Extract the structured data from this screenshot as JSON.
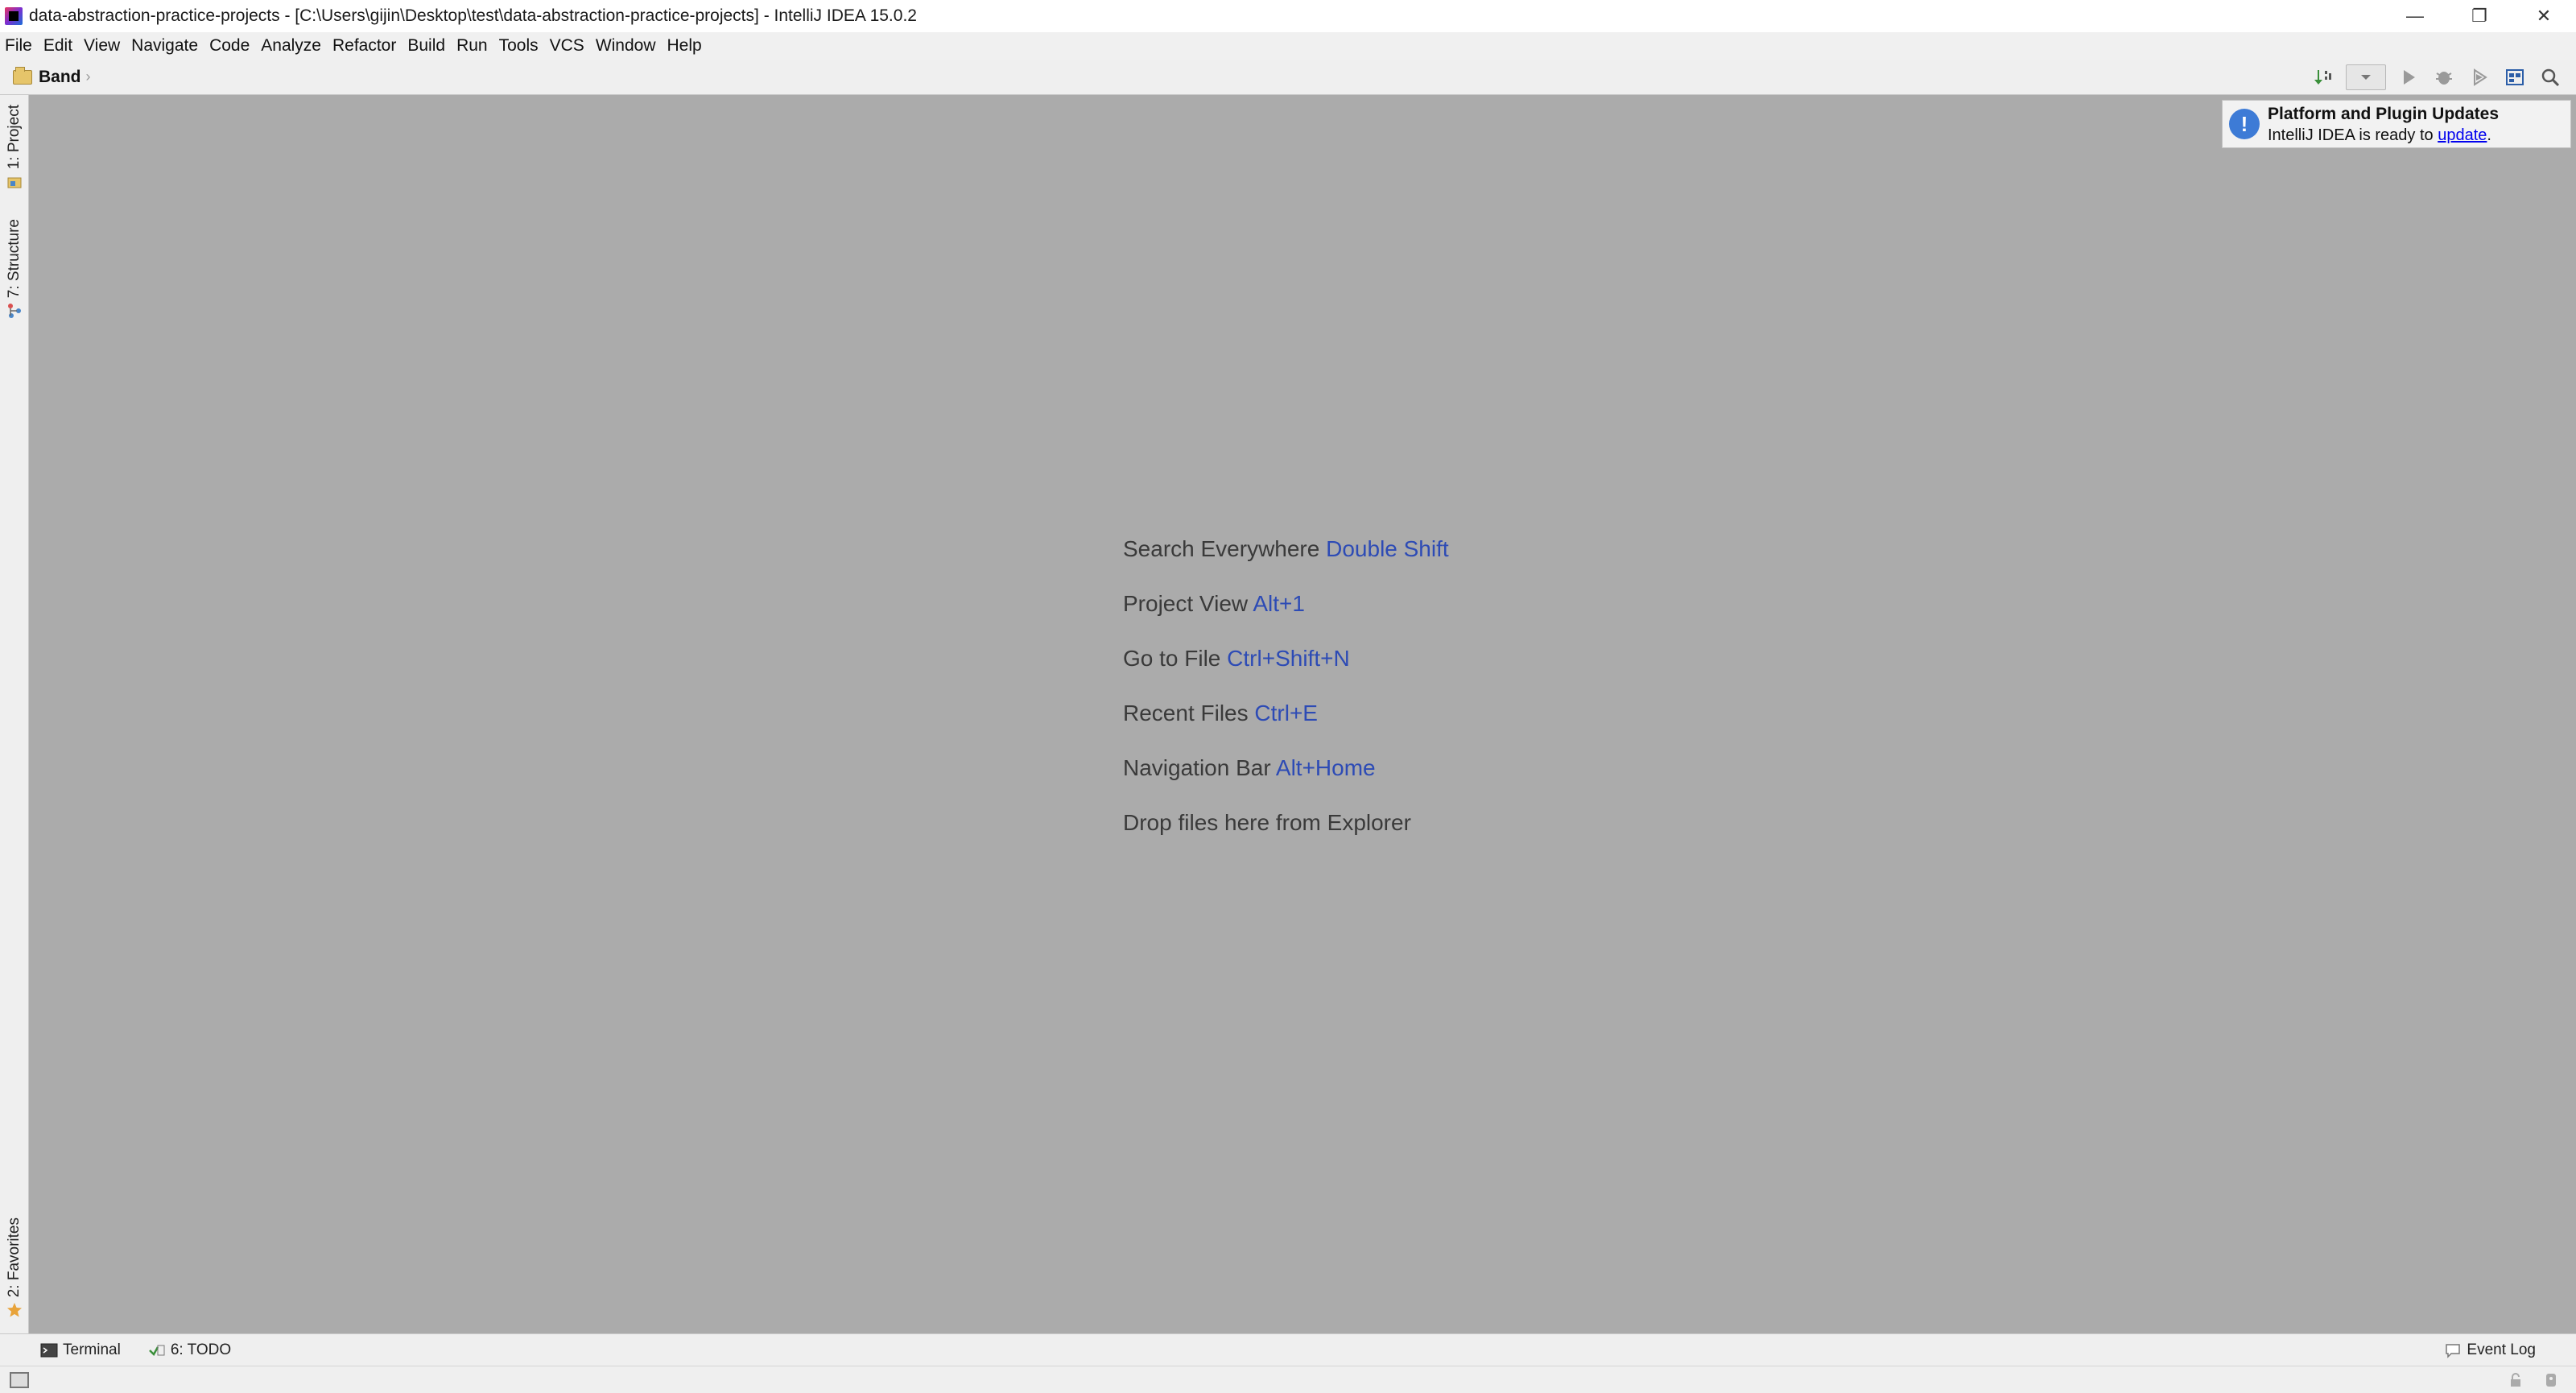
{
  "window": {
    "title": "data-abstraction-practice-projects - [C:\\Users\\gijin\\Desktop\\test\\data-abstraction-practice-projects] - IntelliJ IDEA 15.0.2",
    "controls": {
      "minimize": "—",
      "restore": "❐",
      "close": "✕"
    }
  },
  "menu": [
    "File",
    "Edit",
    "View",
    "Navigate",
    "Code",
    "Analyze",
    "Refactor",
    "Build",
    "Run",
    "Tools",
    "VCS",
    "Window",
    "Help"
  ],
  "navbar": {
    "breadcrumb": "Band"
  },
  "left_strip": {
    "project_tab": "1: Project",
    "structure_tab": "7: Structure",
    "favorites_tab": "2: Favorites"
  },
  "editor_hints": [
    {
      "text": "Search Everywhere",
      "shortcut": "Double Shift"
    },
    {
      "text": "Project View",
      "shortcut": "Alt+1"
    },
    {
      "text": "Go to File",
      "shortcut": "Ctrl+Shift+N"
    },
    {
      "text": "Recent Files",
      "shortcut": "Ctrl+E"
    },
    {
      "text": "Navigation Bar",
      "shortcut": "Alt+Home"
    },
    {
      "text": "Drop files here from Explorer",
      "shortcut": ""
    }
  ],
  "notification": {
    "title": "Platform and Plugin Updates",
    "body_prefix": "IntelliJ IDEA is ready to ",
    "link": "update",
    "body_suffix": "."
  },
  "bottom_bar": {
    "terminal": "Terminal",
    "todo": "6: TODO",
    "event_log": "Event Log"
  },
  "colors": {
    "editor_bg": "#ababab",
    "shortcut": "#2d4bb5",
    "info": "#3d7bd6"
  }
}
